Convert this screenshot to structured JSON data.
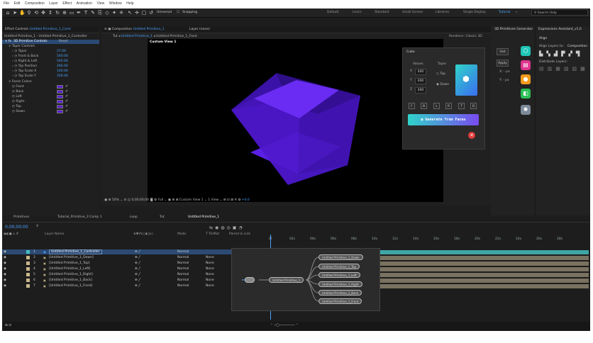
{
  "menu": [
    "File",
    "Edit",
    "Composition",
    "Layer",
    "Effect",
    "Animation",
    "View",
    "Window",
    "Help"
  ],
  "toolbar": {
    "snap_universal": "Universal",
    "snap_label": "Snapping",
    "workspaces": [
      "Default",
      "Learn",
      "Standard",
      "Small Screen",
      "Libraries",
      "Single Display",
      "Tutorial",
      "Expressions Assistant_v1.0"
    ],
    "active_workspace": "Tutorial",
    "search_placeholder": "Search Help"
  },
  "effect_controls": {
    "tab_prefix": "Effect Controls",
    "tab_layer": "Untitled Primitive_1_Contr",
    "breadcrumb": "Untitled Primitive_1 · Untitled Primitive_1_Controller",
    "effect_name": "3D Primitive Controls",
    "reset": "Reset",
    "section_taper": "Taper Controls",
    "params": [
      {
        "label": "Taper",
        "value": "27.00"
      },
      {
        "label": "Front & Back",
        "value": "540.00"
      },
      {
        "label": "Right & Left",
        "value": "540.00"
      },
      {
        "label": "Top Position",
        "value": "260.00"
      },
      {
        "label": "Top Scale X",
        "value": "100.00"
      },
      {
        "label": "Top Scale Y",
        "value": "100.00"
      }
    ],
    "section_faces": "Faces Colors",
    "faces": [
      {
        "label": "Front",
        "color": "#5a1fd0"
      },
      {
        "label": "Back",
        "color": "#5a1fd0"
      },
      {
        "label": "Left",
        "color": "#5a1fd0"
      },
      {
        "label": "Right",
        "color": "#5a1fd0"
      },
      {
        "label": "Top",
        "color": "#5a1fd0"
      },
      {
        "label": "Down",
        "color": "#5a1fd0"
      }
    ]
  },
  "viewer": {
    "tab_prefix": "Composition",
    "tab_comp": "Untitled Primitive_1",
    "layer_tab": "Layer (none)",
    "breadcrumb": [
      "Untitled Primitive_1",
      "Untitled Primitive_1_Front"
    ],
    "renderer": "Renderer: Classic 3D",
    "view_label": "Custom View 1",
    "zoom": "50%",
    "timecode": "0;00;00;00",
    "resolution": "Full",
    "view_select": "Custom View 1",
    "view_count": "1 View",
    "offset": "+0.0"
  },
  "cube_dialog": {
    "title": "Cube",
    "values_label": "Values",
    "taper_label": "Taper",
    "inputs": [
      {
        "axis": "X",
        "value": "400"
      },
      {
        "axis": "Y",
        "value": "400"
      },
      {
        "axis": "Z",
        "value": "400"
      }
    ],
    "radio_top": "Top",
    "radio_down": "Down",
    "face_buttons": [
      "F",
      "B",
      "L",
      "R",
      "T",
      "D"
    ],
    "generate_label": "Generate from Faces",
    "close_icon": "close-icon"
  },
  "primitives_panel": {
    "title": "3D Primitives Generator",
    "get_label": "Get",
    "apply_label": "Apply",
    "x_label": "X: - px",
    "y_label": "Y: - px",
    "button_colors": [
      "#1fc6b8",
      "#e0348f",
      "#f59a1c",
      "#2bbf55",
      "#7d8a9a"
    ]
  },
  "align_panel": {
    "title": "Align",
    "align_layers_to": "Align Layers to:",
    "align_target": "Composition",
    "distribute": "Distribute Layers:"
  },
  "timeline": {
    "tabs": [
      "Primitives",
      "Tutorial_Primitive_3 Comp 1",
      "Loop",
      "Tut",
      "Untitled Primitive_1"
    ],
    "active_tab": "Untitled Primitive_1",
    "timecode": "0;00;00;00",
    "columns": {
      "layer_name": "Layer Name",
      "mode": "Mode",
      "trkmat": "T TrkMat",
      "parent": "Parent & Link"
    },
    "ruler": [
      "0f",
      "02s",
      "04s",
      "06s",
      "08s",
      "10s",
      "12s",
      "14s",
      "16s",
      "18s",
      "20s",
      "22s",
      "24s",
      "26s",
      "28s"
    ],
    "layers": [
      {
        "num": "1",
        "name": "Untitled Primitive_1_Controller",
        "mode": "Normal",
        "trkmat": "",
        "parent": "None",
        "color": "#44c0c0"
      },
      {
        "num": "2",
        "name": "[Untitled Primitive_1_Down]",
        "mode": "Normal",
        "trkmat": "None",
        "parent": "",
        "color": "#c8b68a"
      },
      {
        "num": "3",
        "name": "[Untitled Primitive_1_Top]",
        "mode": "Normal",
        "trkmat": "None",
        "parent": "",
        "color": "#c8b68a"
      },
      {
        "num": "4",
        "name": "[Untitled Primitive_1_Left]",
        "mode": "Normal",
        "trkmat": "None",
        "parent": "",
        "color": "#c8b68a"
      },
      {
        "num": "5",
        "name": "[Untitled Primitive_1_Right]",
        "mode": "Normal",
        "trkmat": "None",
        "parent": "",
        "color": "#c8b68a"
      },
      {
        "num": "6",
        "name": "[Untitled Primitive_1_Back]",
        "mode": "Normal",
        "trkmat": "None",
        "parent": "",
        "color": "#c8b68a"
      },
      {
        "num": "7",
        "name": "[Untitled Primitive_1_Front]",
        "mode": "Normal",
        "trkmat": "None",
        "parent": "",
        "color": "#c8b68a"
      }
    ]
  },
  "node_graph": {
    "root": "",
    "hub": "Untitled Primitive_1",
    "children": [
      "Untitled Primitive_1_Down",
      "Untitled Primitive_1_Top",
      "Untitled Primitive_1_Left",
      "Untitled Primitive_1_Right",
      "Untitled Primitive_1_Back",
      "Untitled Primitive_1_Front"
    ]
  }
}
